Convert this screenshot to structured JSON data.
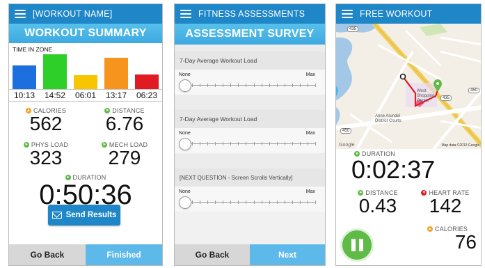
{
  "panel1": {
    "app_title": "[WORKOUT NAME]",
    "banner": "WORKOUT SUMMARY",
    "zone_label": "TIME IN ZONE",
    "chart_data": {
      "type": "bar",
      "categories": [
        "10:13",
        "14:52",
        "06:01",
        "13:17",
        "06:23"
      ],
      "values": [
        10.22,
        14.87,
        6.02,
        13.28,
        6.38
      ],
      "colors": [
        "#1d6fe0",
        "#2fcf2a",
        "#f7c600",
        "#f7941d",
        "#e01b22"
      ],
      "title": "TIME IN ZONE",
      "ylim": [
        0,
        15.5
      ]
    },
    "stats": {
      "calories_label": "CALORIES",
      "calories_value": "562",
      "distance_label": "DISTANCE",
      "distance_value": "6.76",
      "phys_label": "PHYS LOAD",
      "phys_value": "323",
      "mech_label": "MECH LOAD",
      "mech_value": "279",
      "duration_label": "DURATION",
      "duration_value": "0:50:36"
    },
    "send_label": "Send Results",
    "back_label": "Go Back",
    "finished_label": "Finished"
  },
  "panel2": {
    "app_title": "FITNESS ASSESSMENTS",
    "banner": "ASSESSMENT SURVEY",
    "questions": [
      {
        "label": "7-Day Average Workout Load",
        "min": "None",
        "max": "Max"
      },
      {
        "label": "7-Day Average Workout Load",
        "min": "None",
        "max": "Max"
      },
      {
        "label": "[NEXT QUESTION - Screen Scrolls Vertically]",
        "min": "None",
        "max": "Max"
      }
    ],
    "back_label": "Go Back",
    "next_label": "Next"
  },
  "panel3": {
    "app_title": "FREE WORKOUT",
    "map_labels": {
      "west": "West",
      "shopping1": "Shopping",
      "center": "Center",
      "district1": "Anne Arundel",
      "district2": "District Courts",
      "google": "Google",
      "mapdata": "Map data ©2013 Google",
      "route435a": "435",
      "route435b": "435",
      "route450": "450",
      "route450b": "450"
    },
    "duration_label": "DURATION",
    "duration_value": "0:02:37",
    "distance_label": "DISTANCE",
    "distance_value": "0.43",
    "hr_label": "HEART RATE",
    "hr_value": "142",
    "calories_label": "CALORIES",
    "calories_value": "76"
  },
  "colors": {
    "accent": "#1f87c8",
    "green": "#5dbb46",
    "red": "#e01b22",
    "orange": "#f7a11a"
  }
}
